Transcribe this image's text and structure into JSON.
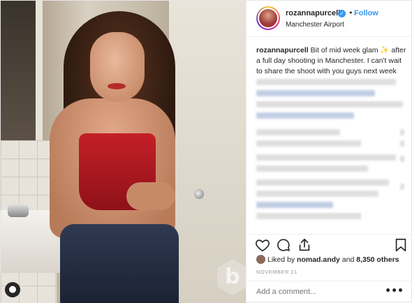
{
  "post": {
    "username": "rozannapurcell",
    "follow_label": "Follow",
    "separator": "•",
    "verified_icon": "verified-badge-icon",
    "location": "Manchester Airport",
    "caption_username": "rozannapurcell",
    "caption_text": "Bit of mid week glam ✨ after a full day shooting in Manchester. I can't wait to share the shoot with you guys next week",
    "likes_prefix": "Liked by ",
    "likes_user": "nomad.andy",
    "likes_middle": " and ",
    "likes_count": "8,350 others",
    "date": "NOVEMBER 21",
    "comment_placeholder": "Add a comment...",
    "more_label": "•••",
    "profile_badge": "●",
    "watermark": "b"
  },
  "colors": {
    "link_blue": "#3897f0",
    "text": "#262626",
    "muted": "#999999",
    "dress_red": "#c41f27"
  },
  "icons": [
    "heart-icon",
    "comment-icon",
    "share-icon",
    "bookmark-icon"
  ]
}
